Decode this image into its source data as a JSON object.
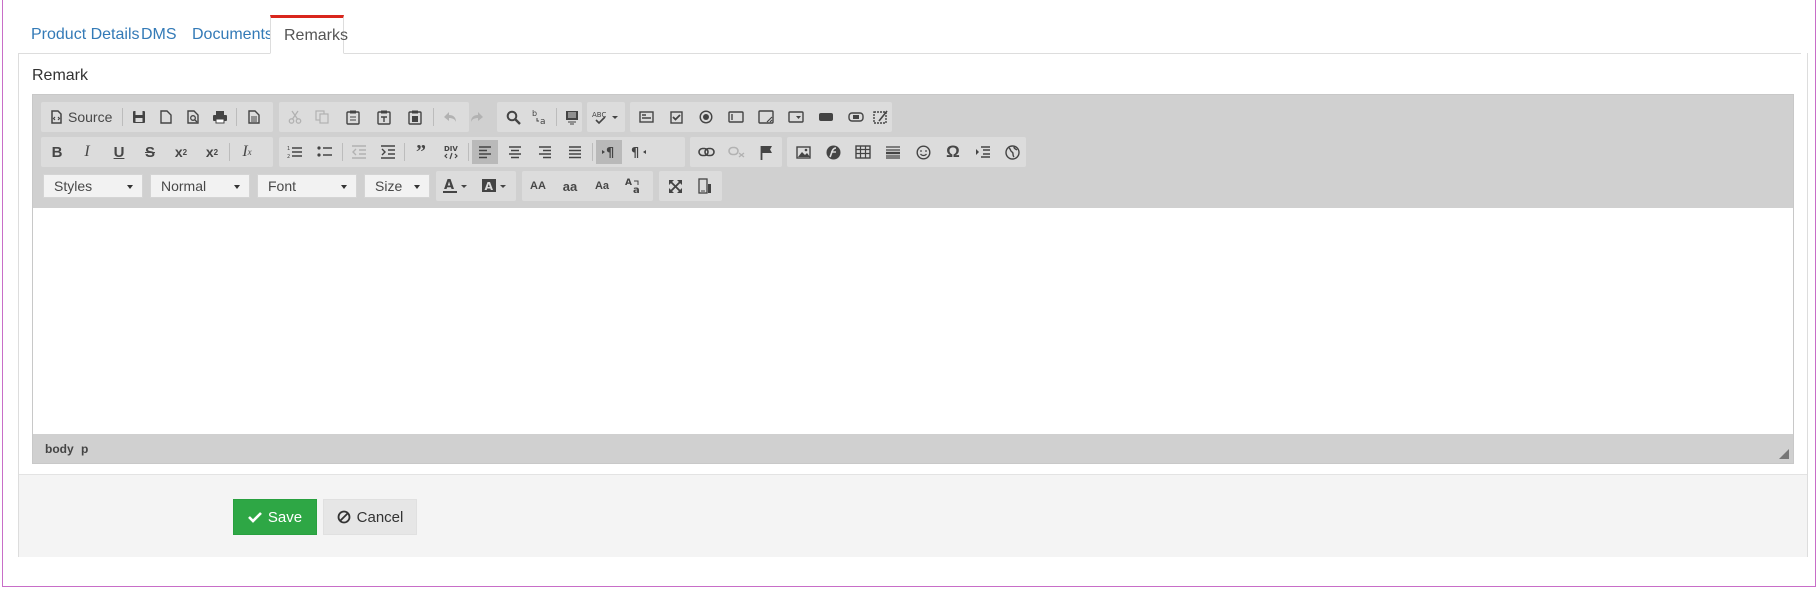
{
  "tabs": [
    {
      "label": "Product Details",
      "active": false
    },
    {
      "label": "DMS",
      "active": false
    },
    {
      "label": "Documents",
      "active": false
    },
    {
      "label": "Remarks",
      "active": true
    }
  ],
  "remark_label": "Remark",
  "toolbar": {
    "source_label": "Source",
    "styles": "Styles",
    "format": "Normal",
    "font": "Font",
    "size": "Size"
  },
  "statusbar": {
    "path": [
      "body",
      "p"
    ]
  },
  "actions": {
    "save_label": "Save",
    "cancel_label": "Cancel"
  },
  "colors": {
    "active_tab_accent": "#d9261c",
    "save": "#2ea745",
    "link": "#337ab7"
  }
}
